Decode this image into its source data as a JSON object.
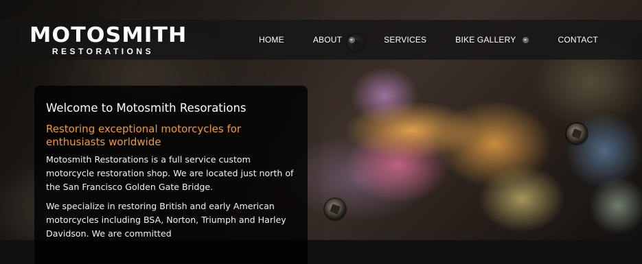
{
  "brand": {
    "name": "MOTOSMITH",
    "sub": "RESTORATIONS"
  },
  "nav": {
    "items": [
      {
        "label": "HOME"
      },
      {
        "label": "ABOUT"
      },
      {
        "label": "SERVICES"
      },
      {
        "label": "BIKE GALLERY"
      },
      {
        "label": "CONTACT"
      }
    ]
  },
  "content": {
    "welcome": "Welcome to Motosmith Resorations",
    "tagline": "Restoring exceptional motorcycles for enthusiasts worldwide",
    "paragraph1": "Motosmith Restorations is a full service custom motorcycle restoration shop. We are located just north of the San Francisco Golden Gate Bridge.",
    "paragraph2": "We specialize in restoring British and early American motorcycles including BSA, Norton, Triumph and Harley Davidson. We are committed"
  },
  "colors": {
    "accent": "#f39a22",
    "header_bg": "#141414",
    "panel_bg": "#000000"
  },
  "icons": {
    "dropdown": "chevron-down-icon"
  }
}
